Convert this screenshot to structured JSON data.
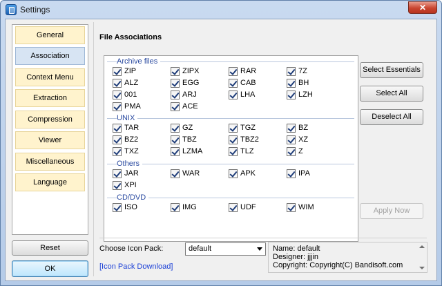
{
  "window": {
    "title": "Settings",
    "close_glyph": "✕"
  },
  "nav": {
    "items": [
      {
        "label": "General",
        "active": false
      },
      {
        "label": "Association",
        "active": true
      },
      {
        "label": "Context Menu",
        "active": false
      },
      {
        "label": "Extraction",
        "active": false
      },
      {
        "label": "Compression",
        "active": false
      },
      {
        "label": "Viewer",
        "active": false
      },
      {
        "label": "Miscellaneous",
        "active": false
      },
      {
        "label": "Language",
        "active": false
      }
    ],
    "reset_label": "Reset",
    "ok_label": "OK"
  },
  "main": {
    "title": "File Associations",
    "groups": [
      {
        "label": "Archive files",
        "items": [
          {
            "label": "ZIP",
            "checked": true
          },
          {
            "label": "ZIPX",
            "checked": true
          },
          {
            "label": "RAR",
            "checked": true
          },
          {
            "label": "7Z",
            "checked": true
          },
          {
            "label": "ALZ",
            "checked": true
          },
          {
            "label": "EGG",
            "checked": true
          },
          {
            "label": "CAB",
            "checked": true
          },
          {
            "label": "BH",
            "checked": true
          },
          {
            "label": "001",
            "checked": true
          },
          {
            "label": "ARJ",
            "checked": true
          },
          {
            "label": "LHA",
            "checked": true
          },
          {
            "label": "LZH",
            "checked": true
          },
          {
            "label": "PMA",
            "checked": true
          },
          {
            "label": "ACE",
            "checked": true
          }
        ]
      },
      {
        "label": "UNIX",
        "items": [
          {
            "label": "TAR",
            "checked": true
          },
          {
            "label": "GZ",
            "checked": true
          },
          {
            "label": "TGZ",
            "checked": true
          },
          {
            "label": "BZ",
            "checked": true
          },
          {
            "label": "BZ2",
            "checked": true
          },
          {
            "label": "TBZ",
            "checked": true
          },
          {
            "label": "TBZ2",
            "checked": true
          },
          {
            "label": "XZ",
            "checked": true
          },
          {
            "label": "TXZ",
            "checked": true
          },
          {
            "label": "LZMA",
            "checked": true
          },
          {
            "label": "TLZ",
            "checked": true
          },
          {
            "label": "Z",
            "checked": true
          }
        ]
      },
      {
        "label": "Others",
        "items": [
          {
            "label": "JAR",
            "checked": true
          },
          {
            "label": "WAR",
            "checked": true
          },
          {
            "label": "APK",
            "checked": true
          },
          {
            "label": "IPA",
            "checked": true
          },
          {
            "label": "XPI",
            "checked": true
          }
        ]
      },
      {
        "label": "CD/DVD",
        "items": [
          {
            "label": "ISO",
            "checked": true
          },
          {
            "label": "IMG",
            "checked": true
          },
          {
            "label": "UDF",
            "checked": true
          },
          {
            "label": "WIM",
            "checked": true
          }
        ]
      }
    ],
    "buttons": {
      "select_essentials": "Select Essentials",
      "select_all": "Select All",
      "deselect_all": "Deselect All",
      "apply_now": "Apply Now"
    }
  },
  "footer": {
    "icon_pack_label": "Choose Icon Pack:",
    "icon_pack_value": "default",
    "icon_pack_link": "[Icon Pack Download]",
    "info": {
      "name": "Name: default",
      "designer": "Designer: jjjin",
      "copyright": "Copyright: Copyright(C) Bandisoft.com"
    }
  },
  "colors": {
    "nav_bg": "#fff3cd",
    "nav_active": "#d7e4f3",
    "group_label": "#2a4aa0",
    "link": "#1a3fd6"
  }
}
